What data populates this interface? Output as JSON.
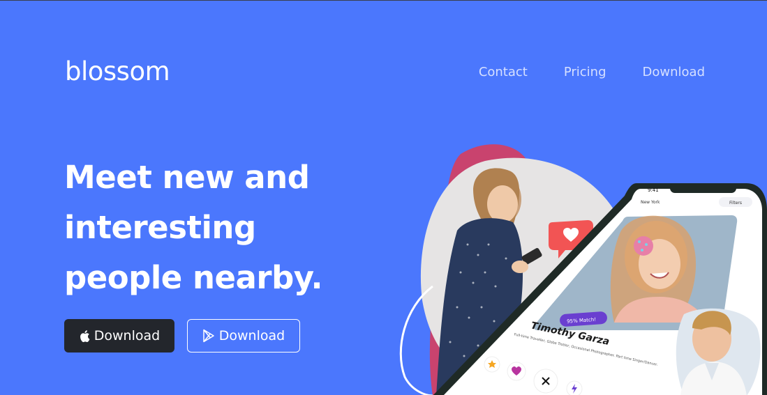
{
  "brand": {
    "name": "blossom"
  },
  "nav": {
    "items": [
      "Contact",
      "Pricing",
      "Download"
    ]
  },
  "hero": {
    "headline_lines": [
      "Meet new and",
      "interesting",
      "people nearby."
    ],
    "buttons": {
      "apple_label": "Download",
      "play_label": "Download"
    }
  },
  "phone": {
    "status_time": "9:41",
    "location": "New York",
    "filters_label": "Filters",
    "match_badge": "95% Match!",
    "profile_name": "Timothy Garza",
    "profile_bio": "Full-time Traveller, Globe Trotter, Occasional Photographer. Part time Singer/Dancer."
  },
  "colors": {
    "background": "#4b77fd",
    "accent_blob": "#c9436e",
    "apple_button": "#23262c"
  }
}
